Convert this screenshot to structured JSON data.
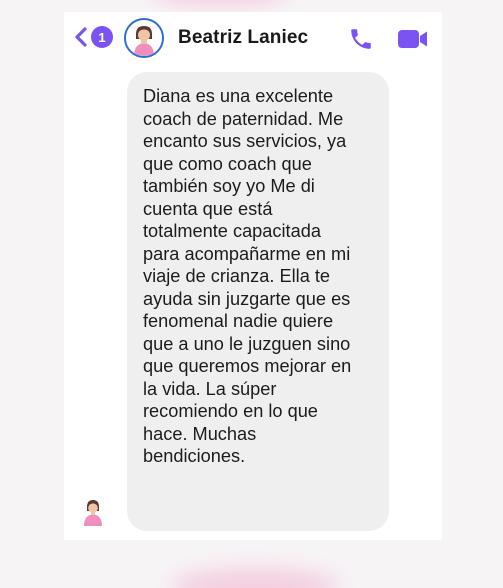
{
  "header": {
    "unread_count": "1",
    "contact_name": "Beatriz Laniec"
  },
  "icons": {
    "back": "chevron-left-icon",
    "phone": "phone-icon",
    "video": "video-camera-icon"
  },
  "colors": {
    "accent": "#7b53f2",
    "avatar_ring": "#2a6fd6",
    "bubble": "#efefef"
  },
  "message": {
    "text": "Diana es una excelente\ncoach de paternidad. Me\nencanto sus servicios, ya\nque como coach que\ntambién soy yo Me di\ncuenta que está\ntotalmente capacitada\npara acompañarme en mi\nviaje de crianza. Ella te\nayuda sin juzgarte que es\nfenomenal nadie quiere\nque a uno le juzguen sino\nque queremos mejorar en\nla vida. La súper\nrecomiendo en lo que\nhace. Muchas\nbendiciones."
  }
}
